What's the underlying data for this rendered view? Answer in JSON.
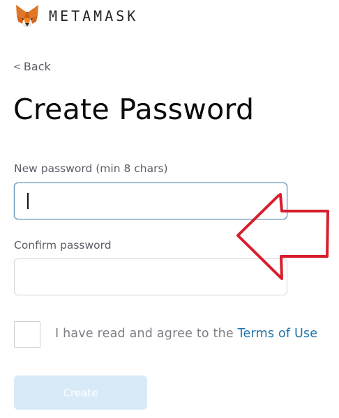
{
  "header": {
    "brand": "METAMASK",
    "logo_icon": "fox-logo-icon"
  },
  "nav": {
    "back_label": "Back",
    "back_icon": "chevron-left-icon"
  },
  "page": {
    "title": "Create Password"
  },
  "form": {
    "new_password": {
      "label": "New password (min 8 chars)",
      "value": "",
      "placeholder": ""
    },
    "confirm_password": {
      "label": "Confirm password",
      "value": "",
      "placeholder": ""
    },
    "terms": {
      "checked": false,
      "text": "I have read and agree to the ",
      "link_label": "Terms of Use"
    },
    "submit_label": "Create"
  },
  "colors": {
    "link": "#1e74a8",
    "annotation_arrow": "#d81e2c",
    "button_disabled_bg": "#d8eaf8",
    "focus_border": "#5f8fb3"
  },
  "annotation": {
    "arrow_icon": "arrow-left-annotation-icon"
  }
}
